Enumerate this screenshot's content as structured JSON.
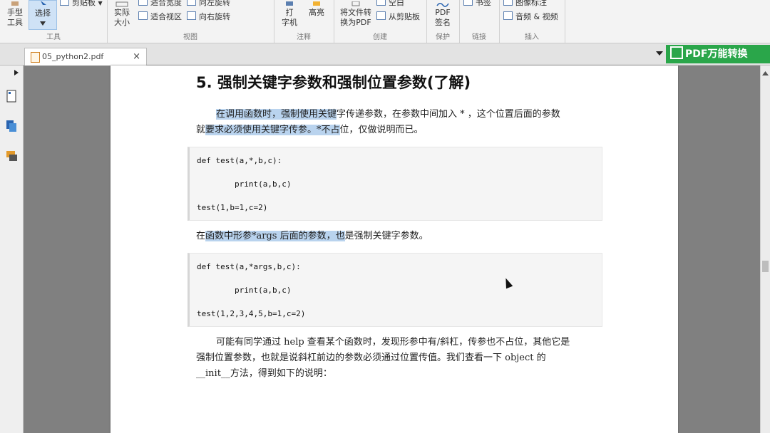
{
  "ribbon": {
    "tools": {
      "hand_line1": "手型",
      "hand_line2": "工具",
      "select": "选择",
      "clipboard": "剪贴板",
      "title": "工具"
    },
    "view": {
      "actual_line1": "实际",
      "actual_line2": "大小",
      "fit_width": "适合宽度",
      "fit_view": "适合视区",
      "rot_left": "向左旋转",
      "rot_right": "向右旋转",
      "title": "视图"
    },
    "annotate": {
      "typewriter_line1": "打",
      "typewriter_line2": "字机",
      "highlight": "高亮",
      "title": "注释"
    },
    "create": {
      "convert_line1": "将文件转",
      "convert_line2": "换为PDF",
      "blank": "空白",
      "from_clipboard": "从剪贴板",
      "title": "创建"
    },
    "protect": {
      "sign_line1": "PDF",
      "sign_line2": "签名",
      "title": "保护"
    },
    "link": {
      "bookmark": "书签",
      "title": "链接"
    },
    "insert": {
      "image_annot": "图像标注",
      "audio_video": "音频 & 视频",
      "title": "插入"
    }
  },
  "tab": {
    "filename": "05_python2.pdf",
    "close": "×"
  },
  "banner": {
    "text": "PDF万能转换"
  },
  "document": {
    "heading": "5. 强制关键字参数和强制位置参数(了解)",
    "p1": {
      "line1_hl": "在调用函数时，强制使用关键",
      "line1_rest": "字传递参数，在参数中间加入 * ，这个位置后面的参数",
      "line2_pre": "就",
      "line2_hl": "要求必须使用关键字传参。*不占",
      "line2_rest": "位，仅做说明而已。"
    },
    "code1": {
      "l1": "def test(a,*,b,c):",
      "l2": "        print(a,b,c)",
      "l3": "test(1,b=1,c=2)"
    },
    "p2": {
      "pre": "在",
      "hl": "函数中形参*args 后面的参数，也",
      "rest": "是强制关键字参数。"
    },
    "code2": {
      "l1": "def test(a,*args,b,c):",
      "l2": "        print(a,b,c)",
      "l3": "test(1,2,3,4,5,b=1,c=2)"
    },
    "p3": {
      "line1": "可能有同学通过 help 查看某个函数时，发现形参中有/斜杠，传参也不占位，其他它是",
      "line2": "强制位置参数，也就是说斜杠前边的参数必须通过位置传值。我们查看一下 object 的",
      "line3": "__init__方法，得到如下的说明："
    }
  },
  "colors": {
    "accent": "#2aa64a",
    "highlight": "#b9d3ee"
  }
}
